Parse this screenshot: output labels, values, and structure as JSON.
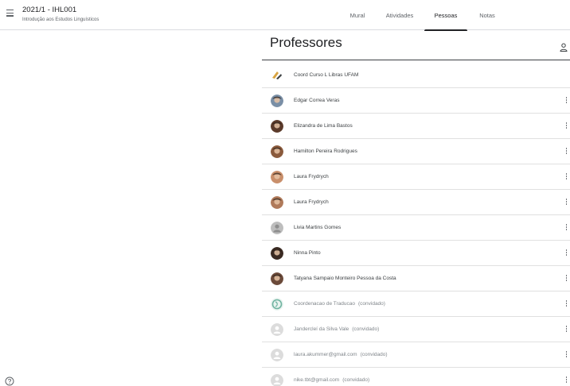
{
  "header": {
    "class_title": "2021/1 - IHL001",
    "class_subtitle": "Introdução aos Estudos Linguísticos",
    "menu_icon": "hamburger-menu-icon"
  },
  "tabs": [
    {
      "label": "Mural",
      "active": false
    },
    {
      "label": "Atividades",
      "active": false
    },
    {
      "label": "Pessoas",
      "active": true
    },
    {
      "label": "Notas",
      "active": false
    }
  ],
  "section": {
    "title": "Professores",
    "invite_icon": "add-person-icon"
  },
  "teachers": [
    {
      "name": "Coord Curso L Libras UFAM",
      "invited": false,
      "tag": "",
      "has_menu": false
    },
    {
      "name": "Edgar Correa Veras",
      "invited": false,
      "tag": "",
      "has_menu": true
    },
    {
      "name": "Elizandra de Lima Bastos",
      "invited": false,
      "tag": "",
      "has_menu": true
    },
    {
      "name": "Hamilton Pereira Rodrigues",
      "invited": false,
      "tag": "",
      "has_menu": true
    },
    {
      "name": "Laura Frydrych",
      "invited": false,
      "tag": "",
      "has_menu": true
    },
    {
      "name": "Laura Frydrych",
      "invited": false,
      "tag": "",
      "has_menu": true
    },
    {
      "name": "Livia Martins Gomes",
      "invited": false,
      "tag": "",
      "has_menu": true
    },
    {
      "name": "Ninna Pinto",
      "invited": false,
      "tag": "",
      "has_menu": true
    },
    {
      "name": "Tatyana Sampaio Monteiro Pessoa da Costa",
      "invited": false,
      "tag": "",
      "has_menu": true
    },
    {
      "name": "Coordenacao de Traducao",
      "invited": true,
      "tag": "(convidado)",
      "has_menu": true
    },
    {
      "name": "Jandercleí da Silva Vale",
      "invited": true,
      "tag": "(convidado)",
      "has_menu": true
    },
    {
      "name": "laura.akummer@gmail.com",
      "invited": true,
      "tag": "(convidado)",
      "has_menu": true
    },
    {
      "name": "nike.tbt@gmail.com",
      "invited": true,
      "tag": "(convidado)",
      "has_menu": true
    }
  ],
  "avatar_colors": [
    "#d9a441",
    "#7a8fa6",
    "#5b3a2a",
    "#8a5a3c",
    "#c98f6b",
    "#b07a5a",
    "#bdbdbd",
    "#3a2a22",
    "#6b4a3a",
    "#6fb3a0",
    "#dcdcdc",
    "#dcdcdc",
    "#dcdcdc"
  ],
  "footer": {
    "help_icon": "help-circle-icon"
  }
}
